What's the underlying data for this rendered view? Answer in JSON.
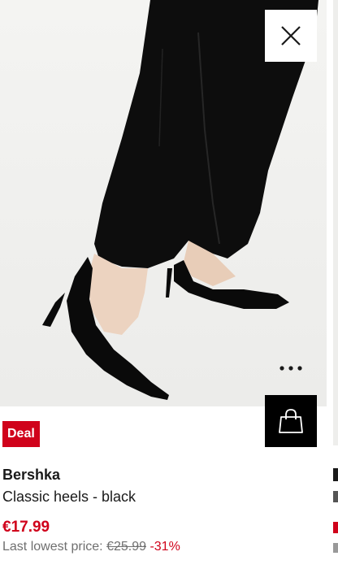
{
  "product": {
    "badge": "Deal",
    "brand": "Bershka",
    "name": "Classic heels - black",
    "price": "€17.99",
    "lowest_price_label": "Last lowest price:",
    "old_price": "€25.99",
    "discount": "-31%"
  },
  "icons": {
    "close": "close-icon",
    "more": "more-options-icon",
    "cart": "shopping-bag-icon"
  },
  "colors": {
    "sale_red": "#d0021b",
    "cart_bg": "#000000",
    "text": "#1a1a1a",
    "muted": "#6f6f6f"
  }
}
